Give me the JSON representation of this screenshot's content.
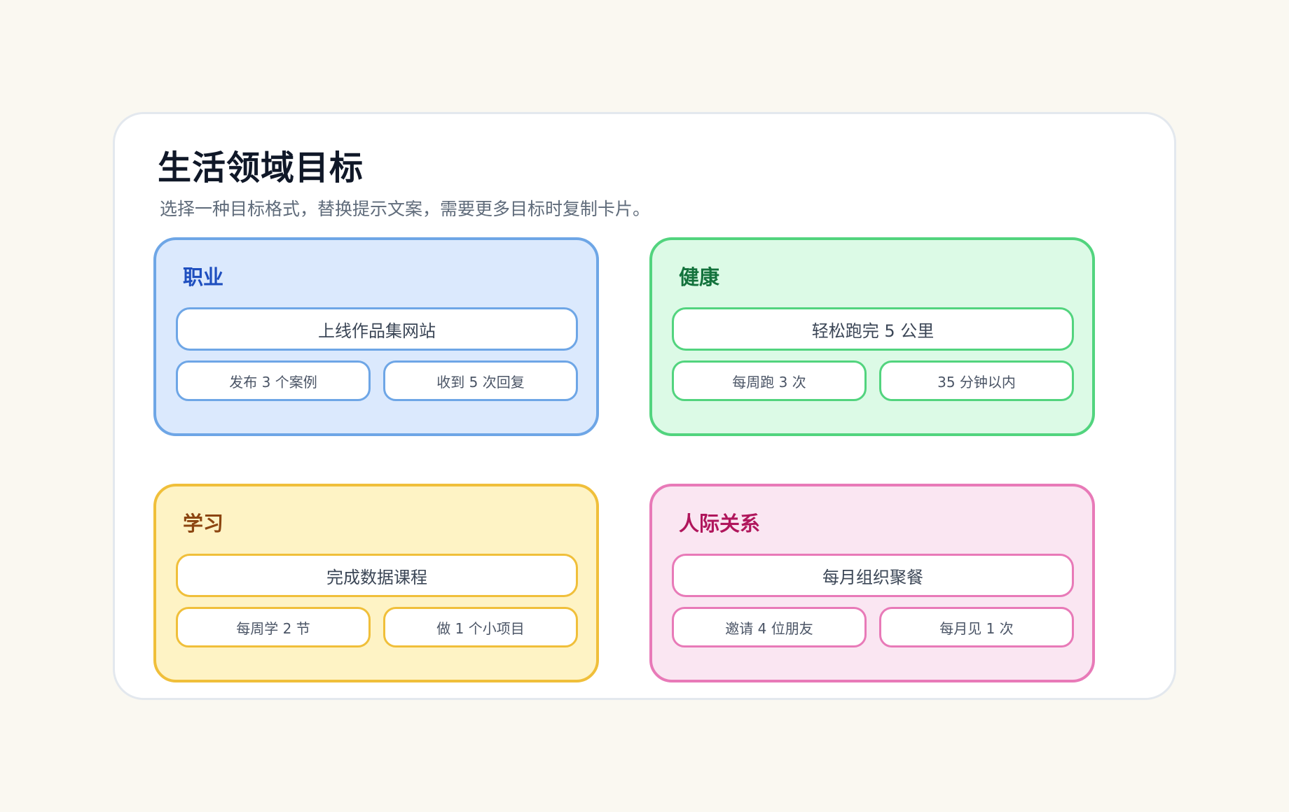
{
  "header": {
    "title": "生活领域目标",
    "subtitle": "选择一种目标格式，替换提示文案，需要更多目标时复制卡片。"
  },
  "colors": {
    "page_background": "#faf8f1",
    "frame_background": "#ffffff"
  },
  "cards": [
    {
      "label": "职业",
      "goal": "上线作品集网站",
      "sub1": "发布 3 个案例",
      "sub2": "收到 5 次回复",
      "colors": {
        "fill": "#dbe9fd",
        "border": "#6ea6e6",
        "label": "#1f4fbf"
      }
    },
    {
      "label": "健康",
      "goal": "轻松跑完 5 公里",
      "sub1": "每周跑 3 次",
      "sub2": "35 分钟以内",
      "colors": {
        "fill": "#dcfae6",
        "border": "#52d47e",
        "label": "#13723c"
      }
    },
    {
      "label": "学习",
      "goal": "完成数据课程",
      "sub1": "每周学 2 节",
      "sub2": "做 1 个小项目",
      "colors": {
        "fill": "#fef3c5",
        "border": "#f0bf3a",
        "label": "#8c4510"
      }
    },
    {
      "label": "人际关系",
      "goal": "每月组织聚餐",
      "sub1": "邀请 4 位朋友",
      "sub2": "每月见 1 次",
      "colors": {
        "fill": "#fae6f2",
        "border": "#e87ab8",
        "label": "#b0165c"
      }
    }
  ]
}
